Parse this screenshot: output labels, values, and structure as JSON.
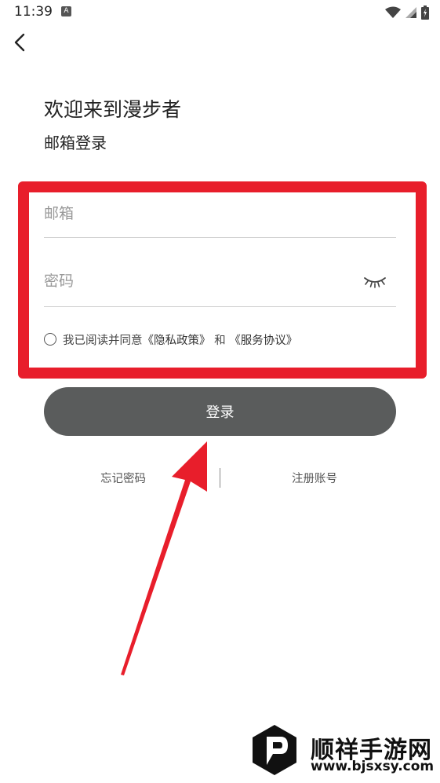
{
  "status": {
    "time": "11:39",
    "notif_badge": "A"
  },
  "header": {
    "welcome": "欢迎来到漫步者",
    "subtitle": "邮箱登录"
  },
  "form": {
    "email_placeholder": "邮箱",
    "password_placeholder": "密码",
    "agree": {
      "prefix": "我已阅读并同意",
      "privacy_link": "《隐私政策》",
      "and": " 和 ",
      "terms_link": "《服务协议》"
    },
    "login_label": "登录"
  },
  "links": {
    "forgot": "忘记密码",
    "register": "注册账号"
  },
  "watermark": {
    "title": "顺祥手游网",
    "url": "www.bjsxsy.com"
  },
  "colors": {
    "highlight": "#e81e2b",
    "button": "#5a5c5c"
  },
  "icons": [
    "back-icon",
    "eye-closed-icon",
    "wifi-icon",
    "signal-icon",
    "battery-icon",
    "notification-icon"
  ]
}
